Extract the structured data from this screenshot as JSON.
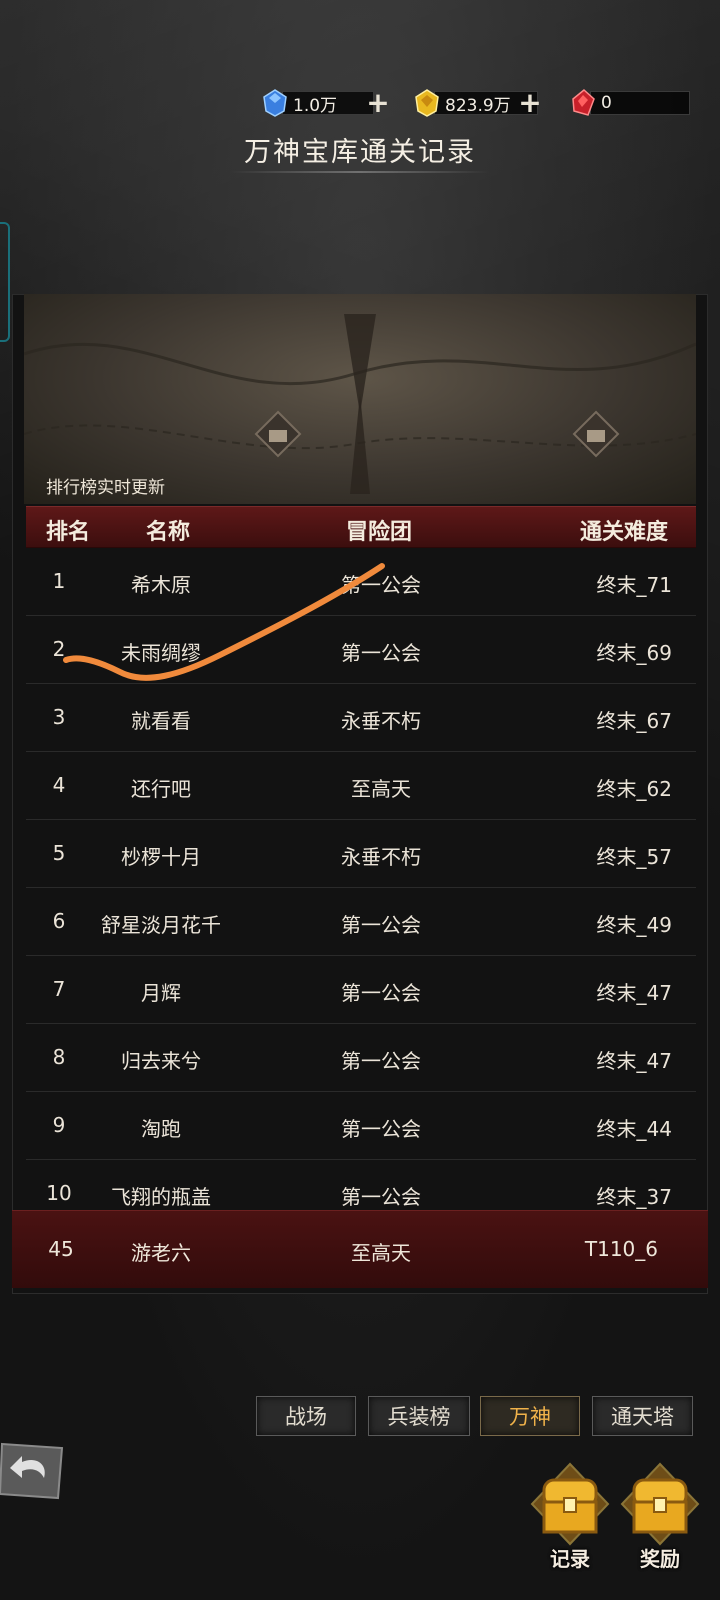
{
  "currencies": {
    "gem": {
      "value": "1.0万",
      "icon": "blue-gem-icon",
      "color": "#3a7fe0"
    },
    "gold": {
      "value": "823.9万",
      "icon": "gold-coin-icon",
      "color": "#e8b820"
    },
    "red": {
      "value": "0",
      "icon": "red-crystal-icon",
      "color": "#c8202a"
    }
  },
  "title": "万神宝库通关记录",
  "realtime_note": "排行榜实时更新",
  "table": {
    "headers": {
      "rank": "排名",
      "name": "名称",
      "guild": "冒险团",
      "difficulty": "通关难度"
    },
    "rows": [
      {
        "rank": "1",
        "name": "希木原",
        "guild": "第一公会",
        "difficulty": "终末_71"
      },
      {
        "rank": "2",
        "name": "未雨绸缪",
        "guild": "第一公会",
        "difficulty": "终末_69"
      },
      {
        "rank": "3",
        "name": "就看看",
        "guild": "永垂不朽",
        "difficulty": "终末_67"
      },
      {
        "rank": "4",
        "name": "还行吧",
        "guild": "至高天",
        "difficulty": "终末_62"
      },
      {
        "rank": "5",
        "name": "杪椤十月",
        "guild": "永垂不朽",
        "difficulty": "终末_57"
      },
      {
        "rank": "6",
        "name": "舒星淡月花千",
        "guild": "第一公会",
        "difficulty": "终末_49"
      },
      {
        "rank": "7",
        "name": "月辉",
        "guild": "第一公会",
        "difficulty": "终末_47"
      },
      {
        "rank": "8",
        "name": "归去来兮",
        "guild": "第一公会",
        "difficulty": "终末_47"
      },
      {
        "rank": "9",
        "name": "淘跑",
        "guild": "第一公会",
        "difficulty": "终末_44"
      },
      {
        "rank": "10",
        "name": "飞翔的瓶盖",
        "guild": "第一公会",
        "difficulty": "终末_37"
      }
    ],
    "my_row": {
      "rank": "45",
      "name": "游老六",
      "guild": "至高天",
      "difficulty": "T110_6"
    }
  },
  "tabs": [
    {
      "label": "战场",
      "active": false
    },
    {
      "label": "兵装榜",
      "active": false
    },
    {
      "label": "万神",
      "active": true
    },
    {
      "label": "通天塔",
      "active": false
    }
  ],
  "buttons": {
    "record": "记录",
    "reward": "奖励"
  },
  "colors": {
    "accent_orange": "#f08a3c",
    "header_red": "#5e1818",
    "active_tab": "#f0b24a"
  }
}
